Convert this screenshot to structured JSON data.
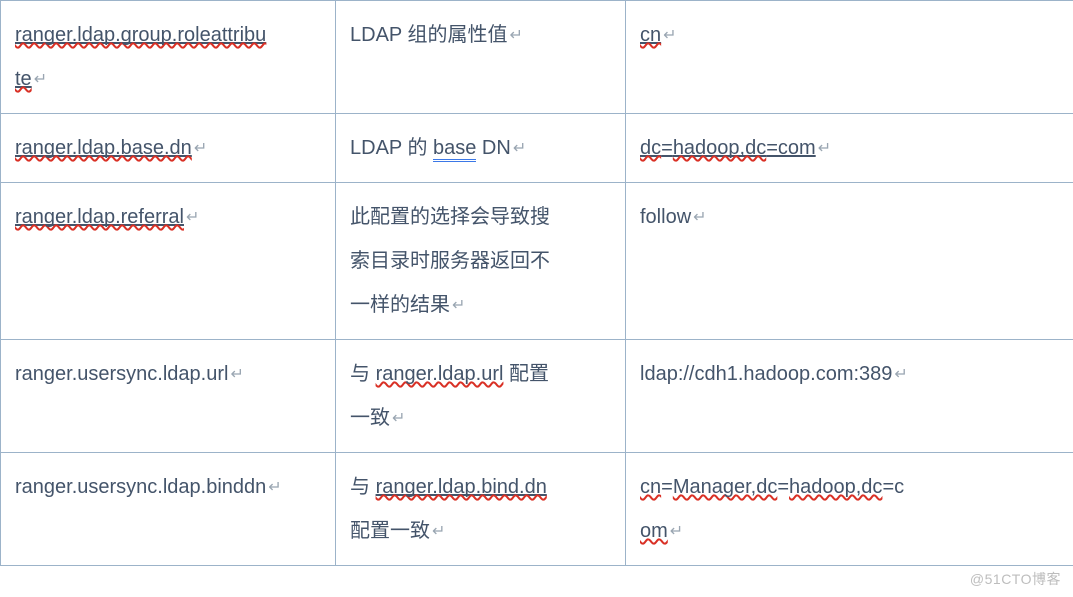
{
  "pilcrow": "↵",
  "watermark": "@51CTO博客",
  "rows": [
    {
      "c1_line1a": "ranger.ldap.group.roleattribu",
      "c1_line2a": "te",
      "c2": "LDAP 组的属性值",
      "c3": "cn"
    },
    {
      "c1a": "ranger.ldap.base.dn",
      "c2a": "LDAP 的 ",
      "c2b": "base",
      "c2c": " DN",
      "c3a": "dc",
      "c3b": "=",
      "c3c": "hadoop,dc",
      "c3d": "=com"
    },
    {
      "c1a": "ranger.ldap.referral",
      "c2_line1": "此配置的选择会导致搜",
      "c2_line2": "索目录时服务器返回不",
      "c2_line3": "一样的结果",
      "c3": "follow"
    },
    {
      "c1": "ranger.usersync.ldap.url",
      "c2_line1a": "与 ",
      "c2_line1b": "ranger.ldap.url",
      "c2_line1c": " 配置",
      "c2_line2": "一致",
      "c3": "ldap://cdh1.hadoop.com:389"
    },
    {
      "c1": "ranger.usersync.ldap.binddn",
      "c2_line1a": "与 ",
      "c2_line1b": "ranger.ldap.bind.dn",
      "c2_line2": "配置一致",
      "c3_line1a": "cn",
      "c3_line1b": "=",
      "c3_line1c": "Manager,dc",
      "c3_line1d": "=",
      "c3_line1e": "hadoop,dc",
      "c3_line1f": "=c",
      "c3_line2a": "om"
    }
  ]
}
